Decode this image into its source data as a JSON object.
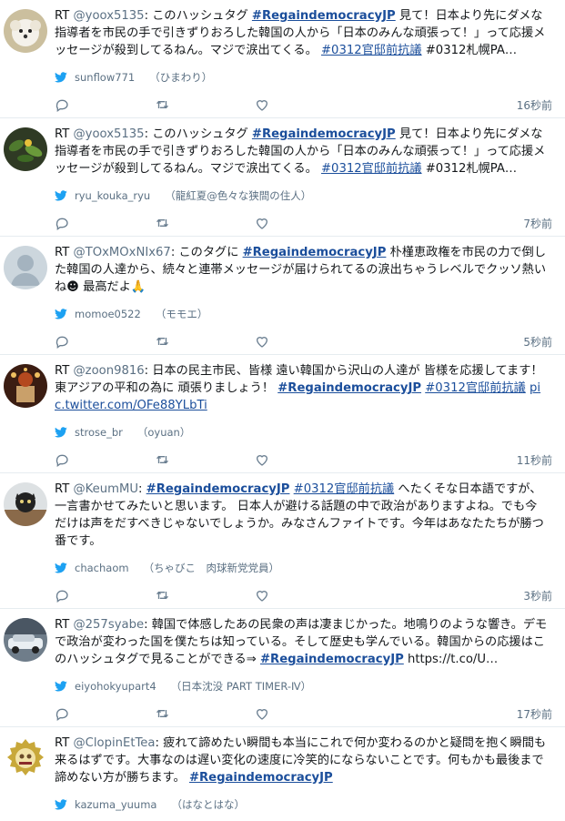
{
  "accent_color": "#1b4e9b",
  "bird_color": "#1da1f2",
  "icons": {
    "reply": "reply-icon",
    "retweet": "retweet-icon",
    "like": "heart-icon",
    "source": "twitter-bird-icon"
  },
  "tweets": [
    {
      "rt": "RT",
      "handle": "@yoox5135",
      "sep": ":",
      "parts": [
        {
          "t": "text",
          "v": " このハッシュタグ "
        },
        {
          "t": "hashtag",
          "v": "#RegaindemocracyJP"
        },
        {
          "t": "text",
          "v": " 見て！日本より先にダメな指導者を市民の手で引きずりおろした韓国の人から「日本のみんな頑張って！」って応援メッセージが殺到してるねん。マジで涙出てくる。 "
        },
        {
          "t": "tag",
          "v": "#0312官邸前抗議"
        },
        {
          "t": "text",
          "v": " #0312札幌PA…"
        }
      ],
      "user": "sunflow771",
      "display": "（ひまわり）",
      "time": "16秒前"
    },
    {
      "rt": "RT",
      "handle": "@yoox5135",
      "sep": ":",
      "parts": [
        {
          "t": "text",
          "v": " このハッシュタグ "
        },
        {
          "t": "hashtag",
          "v": "#RegaindemocracyJP"
        },
        {
          "t": "text",
          "v": " 見て！日本より先にダメな指導者を市民の手で引きずりおろした韓国の人から「日本のみんな頑張って！」って応援メッセージが殺到してるねん。マジで涙出てくる。 "
        },
        {
          "t": "tag",
          "v": "#0312官邸前抗議"
        },
        {
          "t": "text",
          "v": " #0312札幌PA…"
        }
      ],
      "user": "ryu_kouka_ryu",
      "display": "（龍紅夏@色々な狭間の住人）",
      "time": "7秒前"
    },
    {
      "rt": "RT",
      "handle": "@TOxMOxNIx67",
      "sep": ":",
      "parts": [
        {
          "t": "text",
          "v": " このタグに "
        },
        {
          "t": "hashtag",
          "v": "#RegaindemocracyJP"
        },
        {
          "t": "text",
          "v": " 朴槿恵政権を市民の力で倒した韓国の人達から、続々と連帯メッセージが届けられてるの涙出ちゃうレベルでクッソ熱いね☻ 最高だよ🙏"
        }
      ],
      "user": "momoe0522",
      "display": "（モモエ）",
      "time": "5秒前"
    },
    {
      "rt": "RT",
      "handle": "@zoon9816",
      "sep": ":",
      "parts": [
        {
          "t": "text",
          "v": " 日本の民主市民、皆様 遠い韓国から沢山の人達が 皆様を応援してます！ 東アジアの平和の為に 頑張りましょう！ "
        },
        {
          "t": "hashtag",
          "v": "#RegaindemocracyJP"
        },
        {
          "t": "text",
          "v": " "
        },
        {
          "t": "tag",
          "v": "#0312官邸前抗議"
        },
        {
          "t": "text",
          "v": " "
        },
        {
          "t": "tag",
          "v": "pic.twitter.com/OFe88YLbTi"
        }
      ],
      "user": "strose_br",
      "display": "（oyuan）",
      "time": "11秒前"
    },
    {
      "rt": "RT",
      "handle": "@KeumMU",
      "sep": ":",
      "parts": [
        {
          "t": "text",
          "v": " "
        },
        {
          "t": "hashtag",
          "v": "#RegaindemocracyJP"
        },
        {
          "t": "text",
          "v": " "
        },
        {
          "t": "tag",
          "v": "#0312官邸前抗議"
        },
        {
          "t": "text",
          "v": " へたくそな日本語ですが、一言書かせてみたいと思います。 日本人が避ける話題の中で政治がありますよね。でも今だけは声をだすべきじゃないでしょうか。みなさんファイトです。今年はあなたたちが勝つ番です。"
        }
      ],
      "user": "chachaom",
      "display": "（ちゃびこ　肉球新党党員）",
      "time": "3秒前"
    },
    {
      "rt": "RT",
      "handle": "@257syabe",
      "sep": ":",
      "parts": [
        {
          "t": "text",
          "v": " 韓国で体感したあの民衆の声は凄まじかった。地鳴りのような響き。デモで政治が変わった国を僕たちは知っている。そして歴史も学んでいる。韓国からの応援はこのハッシュタグで見ることができる⇒ "
        },
        {
          "t": "hashtag",
          "v": "#RegaindemocracyJP"
        },
        {
          "t": "text",
          "v": " https://t.co/U…"
        }
      ],
      "user": "eiyohokyupart4",
      "display": "（日本沈没 PART TIMER-Ⅳ）",
      "time": "17秒前"
    },
    {
      "rt": "RT",
      "handle": "@ClopinEtTea",
      "sep": ":",
      "parts": [
        {
          "t": "text",
          "v": " 疲れて諦めたい瞬間も本当にこれで何か変わるのかと疑問を抱く瞬間も来るはずです。大事なのは遅い変化の速度に冷笑的にならないことです。何もかも最後まで諦めない方が勝ちます。 "
        },
        {
          "t": "hashtag",
          "v": "#RegaindemocracyJP"
        }
      ],
      "user": "kazuma_yuuma",
      "display": "（はなとはな）",
      "time": ""
    }
  ]
}
